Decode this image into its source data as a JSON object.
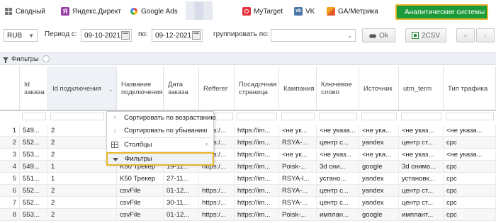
{
  "tabs": [
    {
      "label": "Сводный",
      "icon": "grid-icon"
    },
    {
      "label": "Яндекс.Директ",
      "icon": "yandex-direct-icon"
    },
    {
      "label": "Google Ads",
      "icon": "google-ads-icon"
    },
    {
      "label": "MyTarget",
      "icon": "mytarget-icon"
    },
    {
      "label": "VK",
      "icon": "vk-icon"
    },
    {
      "label": "GA/Метрика",
      "icon": "ga-metrika-icon"
    },
    {
      "label": "Аналитические системы",
      "icon": "analytics-icon",
      "active": true
    }
  ],
  "toolbar": {
    "currency": "RUB",
    "period_label": "Период с:",
    "date_from": "09-10-2021",
    "to_label": "по:",
    "date_to": "09-12-2021",
    "group_label": "группировать по:",
    "group_value": "",
    "ok_label": "Ok",
    "csv_label": "2CSV"
  },
  "filter_bar": {
    "label": "Фильтры"
  },
  "columns": [
    "",
    "Id заказа",
    "Id подключения",
    "Название подключения",
    "Дата заказа",
    "Refferer",
    "Посадочная страница",
    "Кампания",
    "Ключевое слово",
    "Источник",
    "utm_term",
    "Тип трафика"
  ],
  "rows": [
    [
      "1",
      "549...",
      "2",
      "",
      "",
      "https:/...",
      "https://im...",
      "<не ук...",
      "<не указа...",
      "<не ука...",
      "<не указ...",
      "<не указа..."
    ],
    [
      "2",
      "552...",
      "2",
      "",
      "",
      "https:/...",
      "https://im...",
      "RSYA-...",
      "центр с...",
      "yandex",
      "центр ст...",
      "cpc"
    ],
    [
      "3",
      "553...",
      "2",
      "",
      "",
      "https:/...",
      "https://im...",
      "<не ук...",
      "<не указ...",
      "<не ука...",
      "<не указ...",
      "<не указа..."
    ],
    [
      "4",
      "549...",
      "1",
      "K50 Трекер",
      "19-11...",
      "https:/...",
      "https://im...",
      "Poisk-...",
      "3d сни...",
      "google",
      "3d снимо...",
      "cpc"
    ],
    [
      "5",
      "551...",
      "1",
      "K50 Трекер",
      "27-11...",
      "",
      "https://im...",
      "RSYA-l...",
      "устано...",
      "yandex",
      "установк...",
      "cpc"
    ],
    [
      "6",
      "552...",
      "2",
      "csvFile",
      "01-12...",
      "https:/...",
      "https://im...",
      "RSYA-...",
      "центр с...",
      "yandex",
      "центр ст...",
      "cpc"
    ],
    [
      "7",
      "552...",
      "2",
      "csvFile",
      "30-11...",
      "https:/...",
      "https://im...",
      "RSYA-...",
      "центр с...",
      "yandex",
      "центр ст...",
      "cpc"
    ],
    [
      "8",
      "553...",
      "2",
      "csvFile",
      "01-12...",
      "https:/...",
      "https://im...",
      "Poisk-...",
      "имплан...",
      "google",
      "имплант...",
      "cpc"
    ]
  ],
  "context_menu": {
    "sort_asc": "Сортировать по возрастанию",
    "sort_desc": "Сортировать по убыванию",
    "columns": "Столбцы",
    "filters": "Фильтры"
  },
  "colors": {
    "analytics_tab_bg": "#1a9a38",
    "highlight_border": "#e6b52a"
  }
}
